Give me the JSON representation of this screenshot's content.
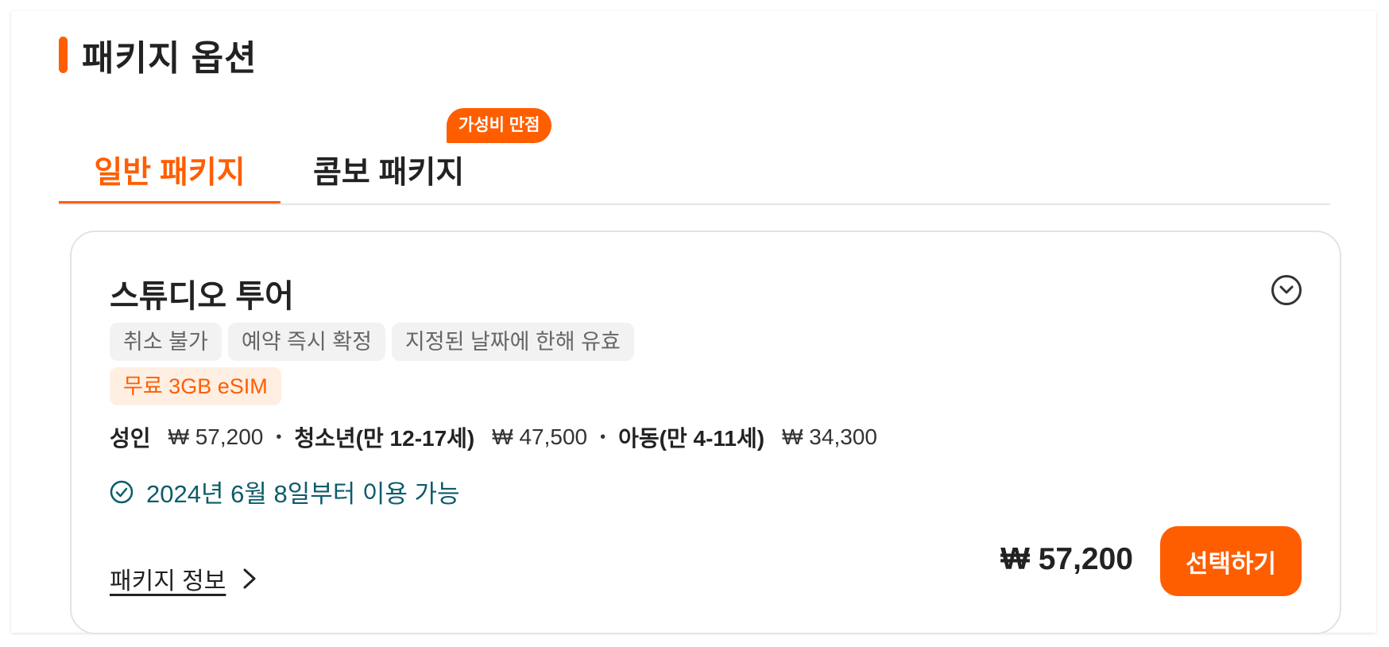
{
  "section": {
    "title": "패키지 옵션"
  },
  "tabs": [
    {
      "label": "일반 패키지",
      "active": true
    },
    {
      "label": "콤보 패키지",
      "active": false,
      "badge": "가성비 만점"
    }
  ],
  "card": {
    "title": "스튜디오 투어",
    "tags": [
      "취소 불가",
      "예약 즉시 확정",
      "지정된 날짜에 한해 유효"
    ],
    "highlight_tag": "무료 3GB eSIM",
    "prices": [
      {
        "label": "성인",
        "value": "₩ 57,200"
      },
      {
        "label": "청소년(만 12-17세)",
        "value": "₩ 47,500"
      },
      {
        "label": "아동(만 4-11세)",
        "value": "₩ 34,300"
      }
    ],
    "availability": "2024년 6월 8일부터 이용 가능",
    "info_link": "패키지 정보",
    "total_price": "₩ 57,200",
    "select_button": "선택하기"
  },
  "colors": {
    "accent": "#ff5e00",
    "availability_text": "#0c5c6b",
    "tag_bg": "#f2f2f2",
    "highlight_bg": "#ffefe3"
  },
  "icons": {
    "expand": "chevron-down-circle-icon",
    "availability": "check-circle-icon",
    "info": "chevron-right-icon"
  }
}
